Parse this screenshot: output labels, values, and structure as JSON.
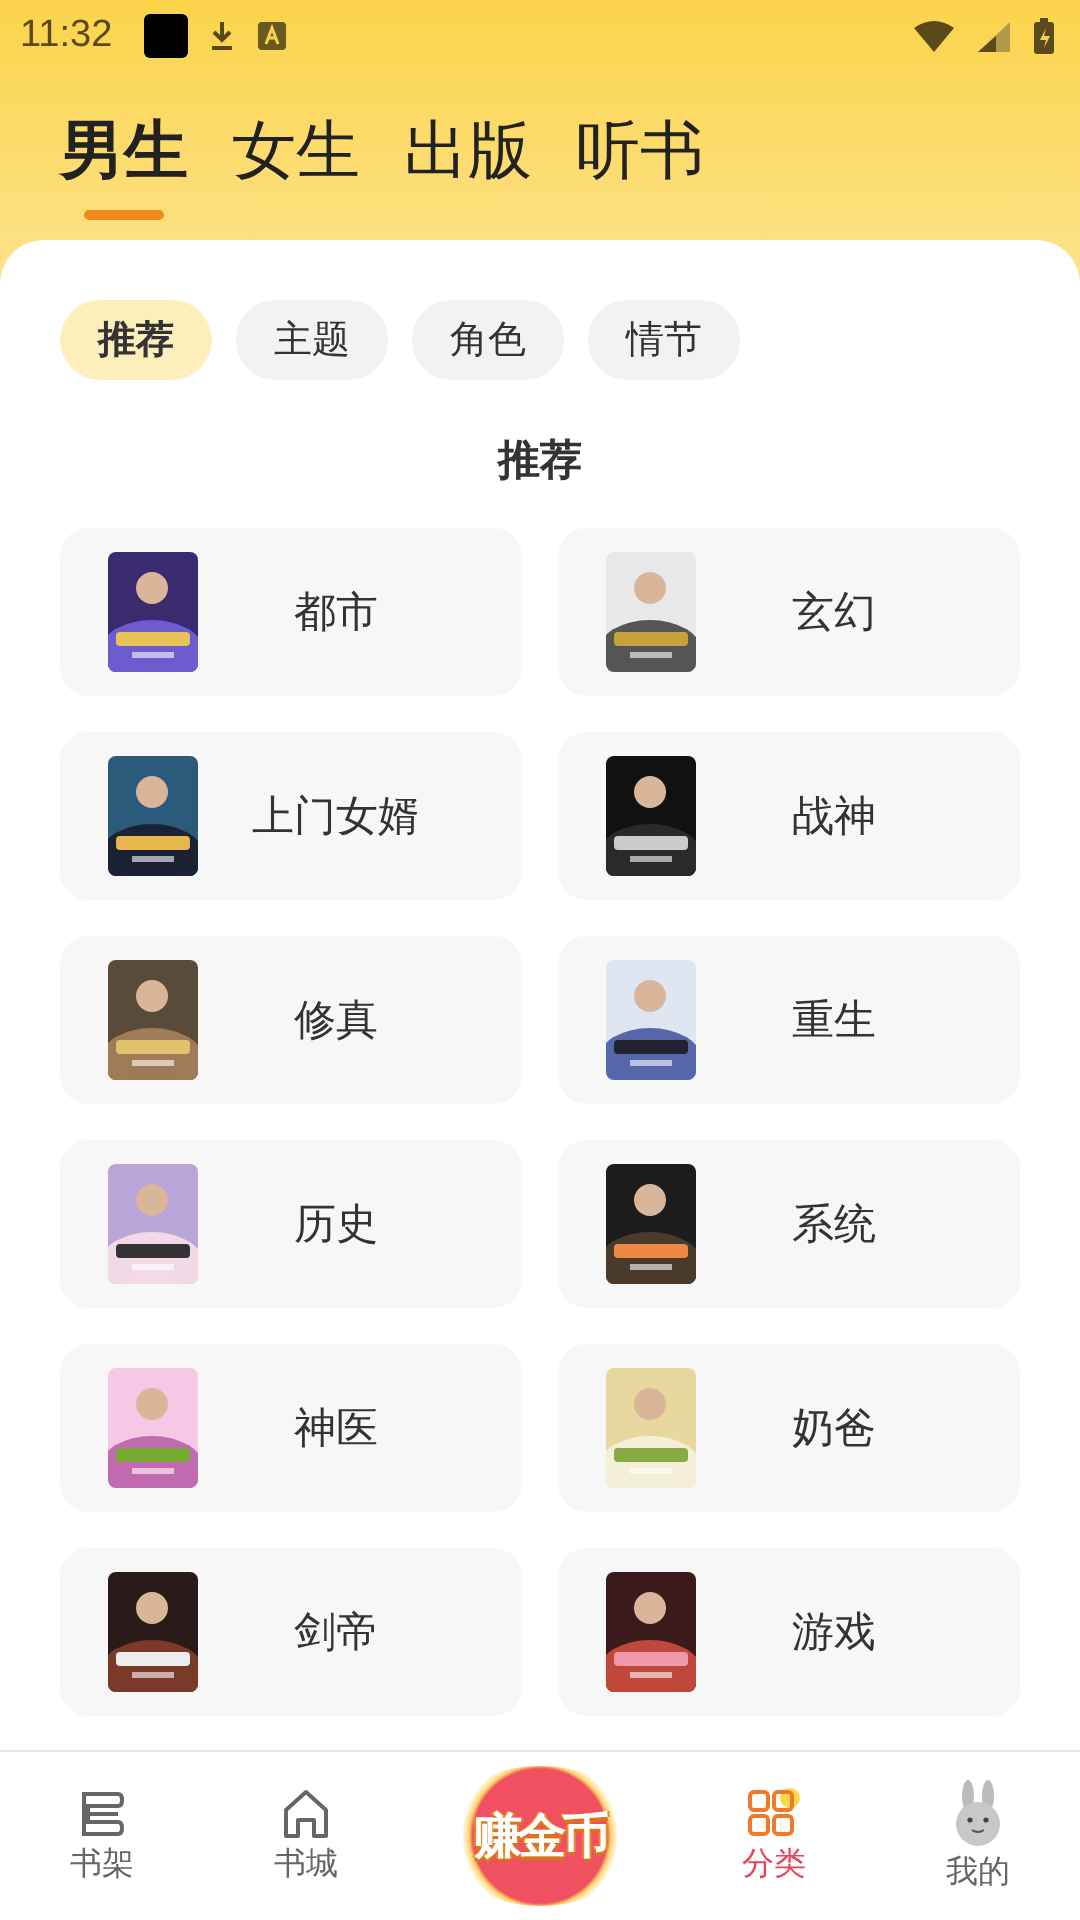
{
  "status_bar": {
    "time": "11:32"
  },
  "top_tabs": [
    {
      "label": "男生",
      "selected": true
    },
    {
      "label": "女生",
      "selected": false
    },
    {
      "label": "出版",
      "selected": false
    },
    {
      "label": "听书",
      "selected": false
    }
  ],
  "chips": [
    {
      "label": "推荐",
      "selected": true
    },
    {
      "label": "主题",
      "selected": false
    },
    {
      "label": "角色",
      "selected": false
    },
    {
      "label": "情节",
      "selected": false
    }
  ],
  "section_title": "推荐",
  "categories": [
    {
      "label": "都市"
    },
    {
      "label": "玄幻"
    },
    {
      "label": "上门女婿"
    },
    {
      "label": "战神"
    },
    {
      "label": "修真"
    },
    {
      "label": "重生"
    },
    {
      "label": "历史"
    },
    {
      "label": "系统"
    },
    {
      "label": "神医"
    },
    {
      "label": "奶爸"
    },
    {
      "label": "剑帝"
    },
    {
      "label": "游戏"
    }
  ],
  "bottom_nav": [
    {
      "kind": "shelf",
      "label": "书架",
      "selected": false
    },
    {
      "kind": "home",
      "label": "书城",
      "selected": false
    },
    {
      "kind": "coin",
      "label": "赚金币",
      "selected": false
    },
    {
      "kind": "grid",
      "label": "分类",
      "selected": true
    },
    {
      "kind": "profile",
      "label": "我的",
      "selected": false
    }
  ]
}
